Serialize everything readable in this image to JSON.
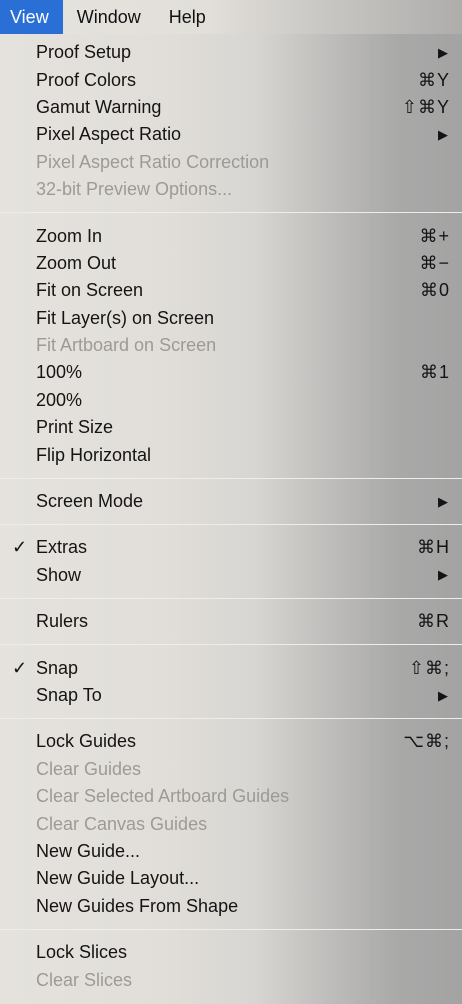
{
  "menubar": {
    "items": [
      {
        "label": "View",
        "active": true
      },
      {
        "label": "Window",
        "active": false
      },
      {
        "label": "Help",
        "active": false
      }
    ]
  },
  "menu": {
    "groups": [
      [
        {
          "label": "Proof Setup",
          "submenu": true,
          "enabled": true
        },
        {
          "label": "Proof Colors",
          "shortcut": "⌘Y",
          "enabled": true
        },
        {
          "label": "Gamut Warning",
          "shortcut": "⇧⌘Y",
          "enabled": true
        },
        {
          "label": "Pixel Aspect Ratio",
          "submenu": true,
          "enabled": true
        },
        {
          "label": "Pixel Aspect Ratio Correction",
          "enabled": false
        },
        {
          "label": "32-bit Preview Options...",
          "enabled": false
        }
      ],
      [
        {
          "label": "Zoom In",
          "shortcut": "⌘+",
          "enabled": true
        },
        {
          "label": "Zoom Out",
          "shortcut": "⌘−",
          "enabled": true
        },
        {
          "label": "Fit on Screen",
          "shortcut": "⌘0",
          "enabled": true
        },
        {
          "label": "Fit Layer(s) on Screen",
          "enabled": true
        },
        {
          "label": "Fit Artboard on Screen",
          "enabled": false
        },
        {
          "label": "100%",
          "shortcut": "⌘1",
          "enabled": true
        },
        {
          "label": "200%",
          "enabled": true
        },
        {
          "label": "Print Size",
          "enabled": true
        },
        {
          "label": "Flip Horizontal",
          "enabled": true
        }
      ],
      [
        {
          "label": "Screen Mode",
          "submenu": true,
          "enabled": true
        }
      ],
      [
        {
          "label": "Extras",
          "shortcut": "⌘H",
          "checked": true,
          "enabled": true
        },
        {
          "label": "Show",
          "submenu": true,
          "enabled": true
        }
      ],
      [
        {
          "label": "Rulers",
          "shortcut": "⌘R",
          "enabled": true
        }
      ],
      [
        {
          "label": "Snap",
          "shortcut": "⇧⌘;",
          "checked": true,
          "enabled": true
        },
        {
          "label": "Snap To",
          "submenu": true,
          "enabled": true
        }
      ],
      [
        {
          "label": "Lock Guides",
          "shortcut": "⌥⌘;",
          "enabled": true
        },
        {
          "label": "Clear Guides",
          "enabled": false
        },
        {
          "label": "Clear Selected Artboard Guides",
          "enabled": false
        },
        {
          "label": "Clear Canvas Guides",
          "enabled": false
        },
        {
          "label": "New Guide...",
          "enabled": true
        },
        {
          "label": "New Guide Layout...",
          "enabled": true
        },
        {
          "label": "New Guides From Shape",
          "enabled": true
        }
      ],
      [
        {
          "label": "Lock Slices",
          "enabled": true
        },
        {
          "label": "Clear Slices",
          "enabled": false
        }
      ]
    ]
  },
  "glyphs": {
    "check": "✓",
    "submenu_arrow": "▶"
  },
  "colors": {
    "accent": "#2a6fd6",
    "disabled_text": "#9d9a96"
  }
}
